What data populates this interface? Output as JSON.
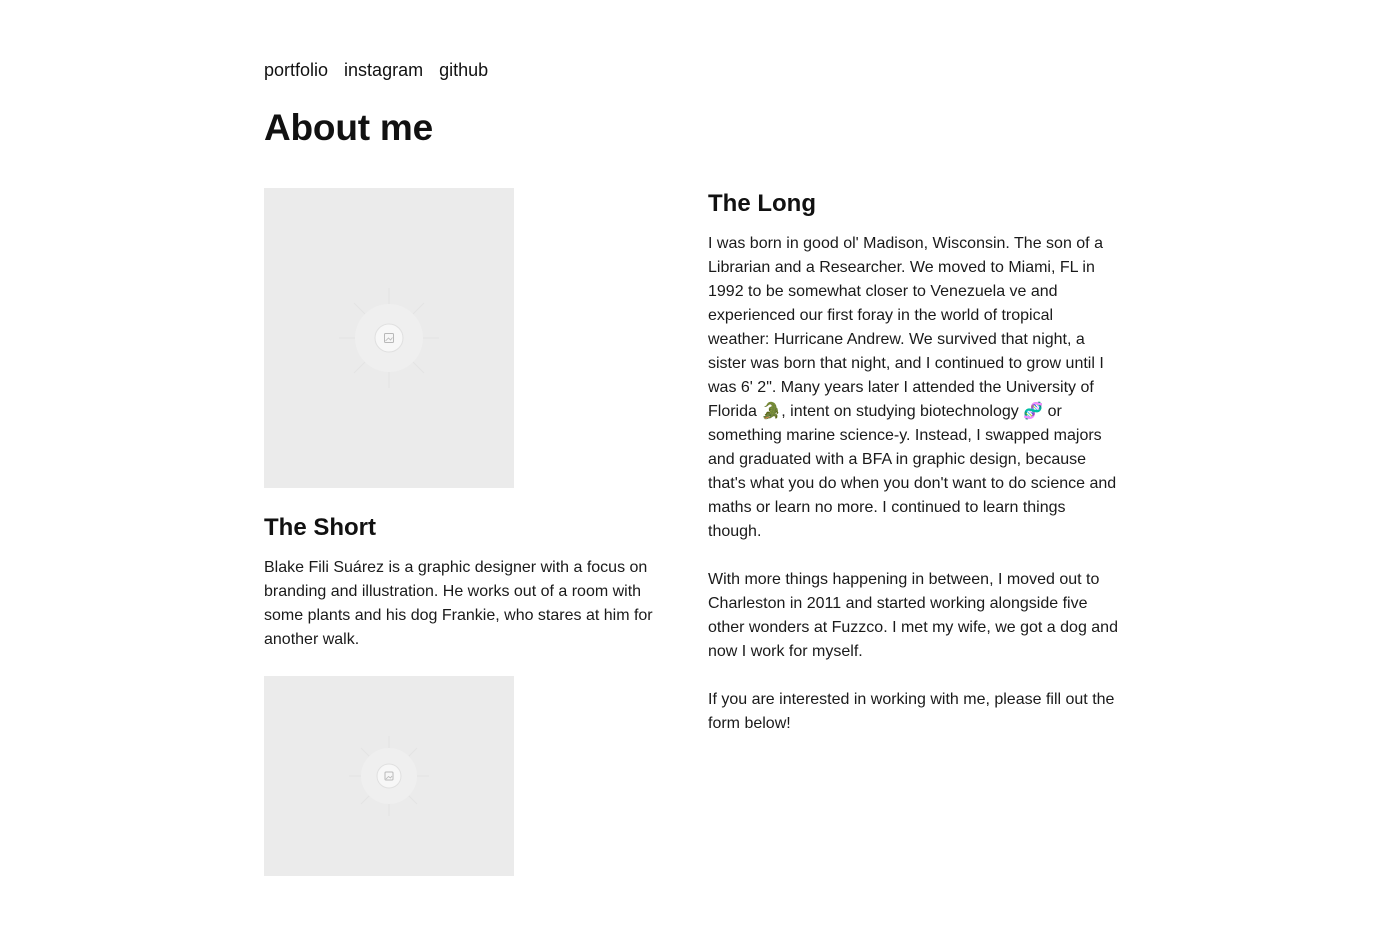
{
  "nav": {
    "items": [
      "portfolio",
      "instagram",
      "github"
    ]
  },
  "page": {
    "title": "About me"
  },
  "short": {
    "heading": "The Short",
    "text": "Blake Fili Suárez is a graphic designer with a focus on branding and illustration. He works out of a room with some plants and his dog Frankie, who stares at him for another walk."
  },
  "long": {
    "heading": "The Long",
    "paragraphs": [
      "I was born in good ol' Madison, Wisconsin. The son of a Librarian and a Researcher. We moved to Miami, FL in 1992 to be somewhat closer to Venezuela ve and experienced our first foray in the world of tropical weather: Hurricane Andrew. We survived that night, a sister was born that night, and I continued to grow until I was 6' 2\". Many years later I attended the University of Florida 🐊, intent on studying biotechnology 🧬 or something marine science-y. Instead, I swapped majors and graduated with a BFA in graphic design, because that's what you do when you don't want to do science and maths or learn no more. I continued to learn things though.",
      "With more things happening in between, I moved out to Charleston in 2011 and started working alongside five other wonders at Fuzzco. I met my wife, we got a dog and now I work for myself.",
      "If you are interested in working with me, please fill out the form below!"
    ]
  },
  "images": {
    "placeholder_icon": "image-icon",
    "background_color": "#ebebeb"
  }
}
